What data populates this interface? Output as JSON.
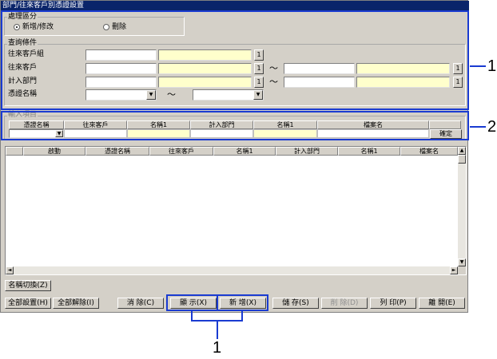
{
  "window": {
    "title": "部門/往來客戶別憑證設置"
  },
  "mode_group": {
    "title": "處理區分",
    "options": [
      {
        "label": "新增/修改",
        "selected": true
      },
      {
        "label": "刪除",
        "selected": false
      }
    ]
  },
  "query_group": {
    "title": "查詢條件",
    "rows": [
      {
        "label": "往來客戶組",
        "btn": "1"
      },
      {
        "label": "往來客戶",
        "btn": "1",
        "tilde": "～",
        "btn2": "1"
      },
      {
        "label": "計入部門",
        "btn": "1",
        "tilde": "～",
        "btn2": "1"
      },
      {
        "label": "憑證名稱",
        "tilde": "～"
      }
    ]
  },
  "entry_group": {
    "title": "輸入項目",
    "headers": [
      "憑證名稱",
      "往來客戶",
      "名稱1",
      "計入部門",
      "名稱1",
      "檔案名"
    ],
    "confirm_label": "確定"
  },
  "grid": {
    "headers": [
      "",
      "啟動",
      "憑證名稱",
      "往來客戶",
      "名稱1",
      "計入部門",
      "名稱1",
      "檔案名"
    ]
  },
  "buttons": {
    "name_switch": "名稱切換(Z)",
    "select_all": "全部設置(H)",
    "clear_all": "全部解除(I)",
    "clear": "消 除(C)",
    "display": "顯 示(X)",
    "add": "新 增(X)",
    "save": "儲 存(S)",
    "delete": "削 除(D)",
    "print": "列 印(P)",
    "close": "離 開(E)"
  },
  "annotations": {
    "callout_1": "1",
    "callout_2": "2",
    "callout_1_bottom": "1"
  },
  "colors": {
    "highlight": "#1a3bd1",
    "yellow_field": "#ffffcc",
    "title_bar": "#0a246a"
  }
}
